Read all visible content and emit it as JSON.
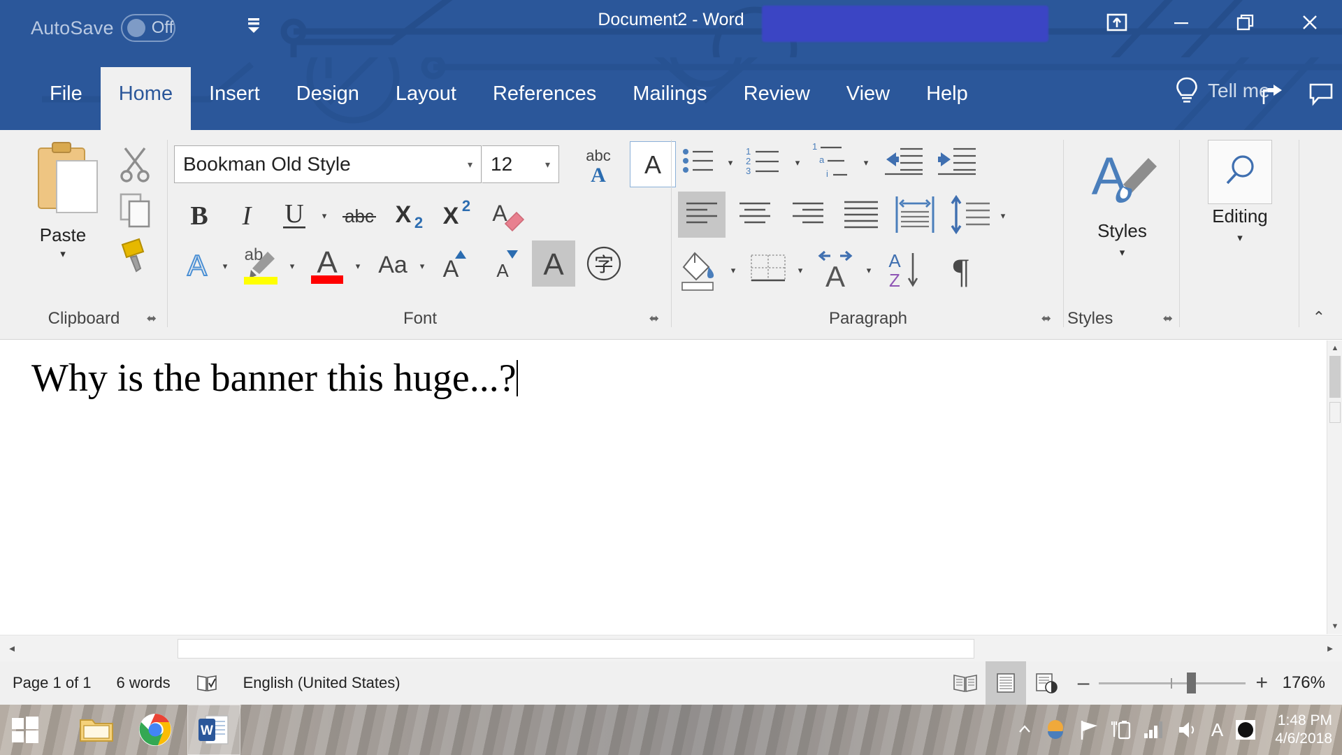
{
  "titlebar": {
    "autosave_label": "AutoSave",
    "autosave_state": "Off",
    "document_title": "Document2  -  Word",
    "quick_access_caret": "▾",
    "ribbon_display_options_icon": "ribbon-display-options-icon",
    "minimize_icon": "minimize-icon",
    "restore_icon": "restore-icon",
    "close_icon": "close-icon",
    "redacted_region": "redacted-account-name"
  },
  "tabs": [
    {
      "label": "File",
      "active": false
    },
    {
      "label": "Home",
      "active": true
    },
    {
      "label": "Insert",
      "active": false
    },
    {
      "label": "Design",
      "active": false
    },
    {
      "label": "Layout",
      "active": false
    },
    {
      "label": "References",
      "active": false
    },
    {
      "label": "Mailings",
      "active": false
    },
    {
      "label": "Review",
      "active": false
    },
    {
      "label": "View",
      "active": false
    },
    {
      "label": "Help",
      "active": false
    }
  ],
  "tellme": {
    "label": "Tell me",
    "lightbulb_icon": "lightbulb-icon",
    "share_icon": "share-icon",
    "comments_icon": "comments-icon"
  },
  "ribbon": {
    "collapse_label": "⌃",
    "groups": {
      "clipboard": {
        "title": "Clipboard",
        "paste_label": "Paste",
        "paste_caret": "▾",
        "cut_label": "Cut",
        "copy_label": "Copy",
        "format_painter_label": "Format Painter",
        "dialog_launcher": "⬌"
      },
      "font": {
        "title": "Font",
        "font_name": "Bookman Old Style",
        "font_size": "12",
        "caret": "▾",
        "bold": "B",
        "italic": "I",
        "underline": "U",
        "strikethrough": "abc",
        "subscript": "X",
        "subscript_sub": "2",
        "superscript": "X",
        "superscript_sup": "2",
        "clear_formatting": "A",
        "text_effects": "A",
        "highlight_letters": "ab",
        "highlight_color": "#ffff00",
        "font_color_letter": "A",
        "font_color": "#ff0000",
        "change_case": "Aa",
        "grow_font": "A",
        "shrink_font": "A",
        "character_shading": "A",
        "character_border": "字",
        "dialog_launcher": "⬌"
      },
      "paragraph": {
        "title": "Paragraph",
        "bullets_label": "Bullets",
        "numbering_label": "Numbering",
        "multilevel_label": "Multilevel List",
        "decrease_indent_label": "Decrease Indent",
        "increase_indent_label": "Increase Indent",
        "align_left_label": "Align Left",
        "center_label": "Center",
        "align_right_label": "Align Right",
        "justify_label": "Justify",
        "distributed_label": "Distributed",
        "line_spacing_label": "Line and Paragraph Spacing",
        "shading_label": "Shading",
        "borders_label": "Borders",
        "asian_spacing_label": "Character Spacing",
        "sort_a": "A",
        "sort_z": "Z",
        "show_marks": "¶",
        "numbering_digits": [
          "1",
          "2",
          "3"
        ],
        "multilevel_marks": [
          "1",
          "a",
          "i"
        ],
        "caret": "▾",
        "dialog_launcher": "⬌"
      },
      "styles": {
        "title": "Styles",
        "button_label": "Styles",
        "caret": "▾",
        "dialog_launcher": "⬌"
      },
      "editing": {
        "title": "Editing",
        "button_label": "Editing",
        "caret": "▾",
        "search_icon": "search-icon"
      }
    }
  },
  "document": {
    "text": "Why is the banner this huge...?",
    "vertical_scrollbar": "vertical-scrollbar",
    "horizontal_scrollbar": "horizontal-scrollbar"
  },
  "statusbar": {
    "page": "Page 1 of 1",
    "words": "6 words",
    "proofing_icon": "proofing-errors-icon",
    "language": "English (United States)",
    "read_mode_icon": "read-mode-icon",
    "print_layout_icon": "print-layout-icon",
    "web_layout_icon": "web-layout-icon",
    "zoom_out": "–",
    "zoom_in": "+",
    "zoom_percent": "176%"
  },
  "taskbar": {
    "start_label": "start-button",
    "apps": [
      {
        "name": "file-explorer",
        "active": false
      },
      {
        "name": "google-chrome",
        "active": false
      },
      {
        "name": "microsoft-word",
        "active": true
      }
    ],
    "tray": {
      "show_hidden_icons": "▲",
      "weather_icon": "weather-icon",
      "flag_icon": "security-flag-icon",
      "battery_icon": "battery-charging-icon",
      "network_icon": "network-signal-icon",
      "volume_icon": "volume-icon",
      "language_icon": "A",
      "night_light_icon": "night-light-icon",
      "time": "1:48 PM",
      "date": "4/6/2018"
    }
  }
}
